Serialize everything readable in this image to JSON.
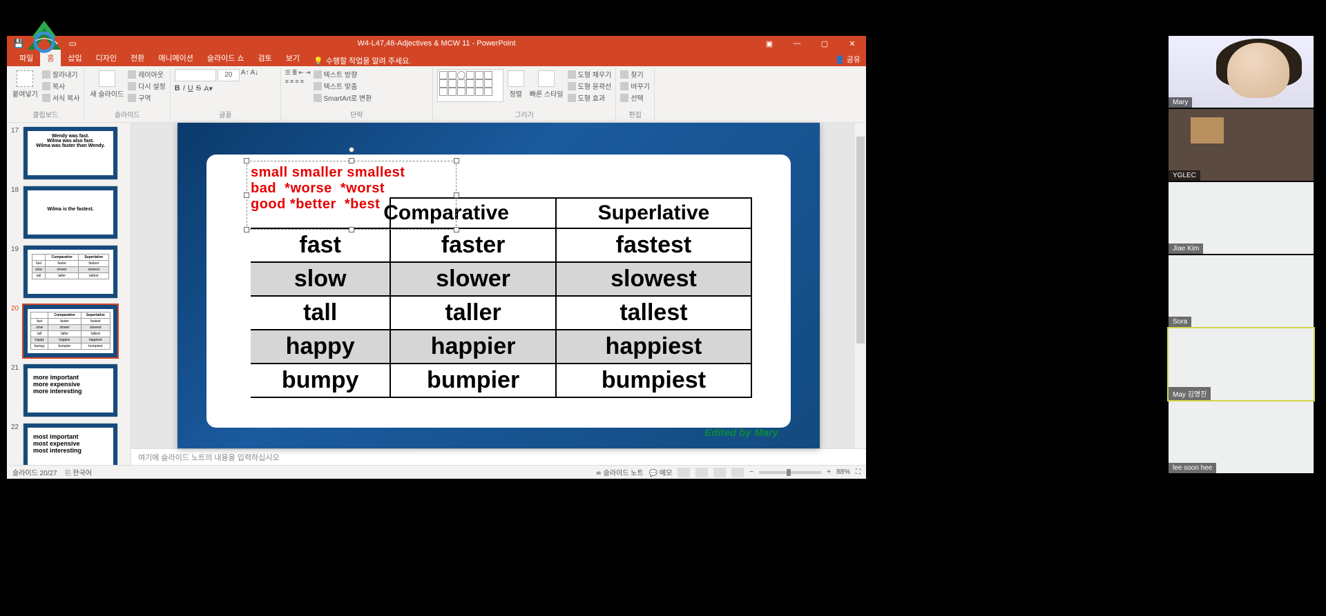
{
  "logo_alt": "AE logo",
  "powerpoint": {
    "title": "W4-L47,48-Adjectives & MCW 11 - PowerPoint",
    "tabs": {
      "file": "파일",
      "home": "홈",
      "insert": "삽입",
      "design": "디자인",
      "transitions": "전환",
      "animations": "애니메이션",
      "slideshow": "슬라이드 쇼",
      "review": "검토",
      "view": "보기"
    },
    "tell_me": "수행할 작업을 알려 주세요.",
    "share": "공유",
    "ribbon": {
      "clipboard": {
        "paste": "붙여넣기",
        "cut": "잘라내기",
        "copy": "복사",
        "format_painter": "서식 복사",
        "group": "클립보드"
      },
      "slides": {
        "new_slide": "새 슬라이드",
        "layout": "레이아웃",
        "reset": "다시 설정",
        "section": "구역",
        "group": "슬라이드"
      },
      "font": {
        "size": "20",
        "group": "글꼴"
      },
      "paragraph": {
        "text_direction": "텍스트 방향",
        "text_align": "텍스트 맞춤",
        "smartart": "SmartArt로 변환",
        "group": "단락"
      },
      "drawing": {
        "arrange": "정렬",
        "quick_style": "빠른 스타일",
        "fill": "도형 채우기",
        "outline": "도형 윤곽선",
        "effects": "도형 효과",
        "group": "그리기"
      },
      "editing": {
        "find": "찾기",
        "replace": "바꾸기",
        "select": "선택",
        "group": "편집"
      }
    },
    "slides_panel": [
      {
        "num": "17",
        "text": "Wendy was fast.\nWilma was also fast.\nWilma was faster than Wendy."
      },
      {
        "num": "18",
        "text": "Wilma is the fastest."
      },
      {
        "num": "19",
        "type": "table"
      },
      {
        "num": "20",
        "type": "table"
      },
      {
        "num": "21",
        "text": "more important\nmore expensive\nmore interesting"
      },
      {
        "num": "22",
        "text": "most important\nmost expensive\nmost interesting"
      }
    ],
    "slide": {
      "textbox": {
        "line1": "small smaller smallest",
        "line2": "bad  *worse  *worst",
        "line3": "good *better  *best"
      },
      "table": {
        "headers": {
          "c2": "Comparative",
          "c3": "Superlative"
        },
        "rows": [
          {
            "c1": "fast",
            "c2": "faster",
            "c3": "fastest"
          },
          {
            "c1": "slow",
            "c2": "slower",
            "c3": "slowest"
          },
          {
            "c1": "tall",
            "c2": "taller",
            "c3": "tallest"
          },
          {
            "c1": "happy",
            "c2": "happier",
            "c3": "happiest"
          },
          {
            "c1": "bumpy",
            "c2": "bumpier",
            "c3": "bumpiest"
          }
        ]
      },
      "credit": "Edited by Mary"
    },
    "notes_placeholder": "여기에 슬라이드 노트의 내용을 입력하십시오",
    "status": {
      "slide_indicator": "슬라이드 20/27",
      "language": "한국어",
      "notes_btn": "슬라이드 노트",
      "comments_btn": "메모",
      "zoom": "88%"
    }
  },
  "participants": [
    {
      "name": "Mary"
    },
    {
      "name": "YGLEC"
    },
    {
      "name": "Jiae Kim"
    },
    {
      "name": "Sora"
    },
    {
      "name": "May 김명진"
    },
    {
      "name": "lee soon hee"
    }
  ]
}
